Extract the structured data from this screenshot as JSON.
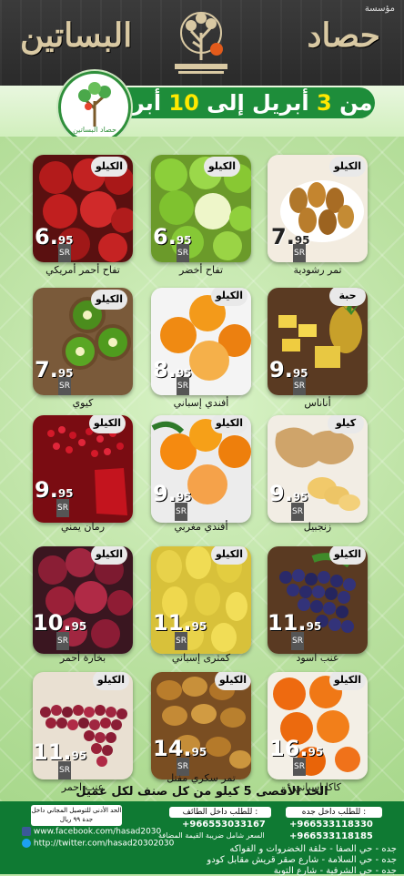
{
  "header": {
    "tag": "مؤسسة",
    "brand_right": "حصاد",
    "brand_left": "البساتين",
    "date_from": "من",
    "date_day1": "3",
    "date_mid": "أبريل إلى",
    "date_day2": "10",
    "date_end": "أبريل",
    "logo_text": "حصاد البساتين"
  },
  "products": [
    {
      "name": "تفاح أحمر أمريكي",
      "unit": "الكيلو",
      "price_int": "6.",
      "price_dec": "95",
      "currency": "SR"
    },
    {
      "name": "تفاح أخضر",
      "unit": "الكيلو",
      "price_int": "6.",
      "price_dec": "95",
      "currency": "SR"
    },
    {
      "name": "تمر رشودية",
      "unit": "الكيلو",
      "price_int": "7.",
      "price_dec": "95",
      "currency": "SR"
    },
    {
      "name": "كيوي",
      "unit": "الكيلو",
      "price_int": "7.",
      "price_dec": "95",
      "currency": "SR"
    },
    {
      "name": "أفندي إسباني",
      "unit": "الكيلو",
      "price_int": "8.",
      "price_dec": "95",
      "currency": "SR"
    },
    {
      "name": "أناناس",
      "unit": "حبة",
      "price_int": "9.",
      "price_dec": "95",
      "currency": "SR"
    },
    {
      "name": "رمان يمني",
      "unit": "الكيلو",
      "price_int": "9.",
      "price_dec": "95",
      "currency": "SR"
    },
    {
      "name": "أفندي مغربي",
      "unit": "الكيلو",
      "price_int": "9.",
      "price_dec": "95",
      "currency": "SR"
    },
    {
      "name": "زنجبيل",
      "unit": "كيلو",
      "price_int": "9.",
      "price_dec": "95",
      "currency": "SR"
    },
    {
      "name": "بخارة أحمر",
      "unit": "الكيلو",
      "price_int": "10.",
      "price_dec": "95",
      "currency": "SR"
    },
    {
      "name": "كمثرى إسباني",
      "unit": "الكيلو",
      "price_int": "11.",
      "price_dec": "95",
      "currency": "SR"
    },
    {
      "name": "عنب اسود",
      "unit": "الكيلو",
      "price_int": "11.",
      "price_dec": "95",
      "currency": "SR"
    },
    {
      "name": "عنب احمر",
      "unit": "الكيلو",
      "price_int": "11.",
      "price_dec": "95",
      "currency": "SR"
    },
    {
      "name": "تمر سكري مفتل",
      "unit": "الكيلو",
      "price_int": "14.",
      "price_dec": "95",
      "currency": "SR"
    },
    {
      "name": "كاكا إسباني",
      "unit": "الكيلو",
      "price_int": "16.",
      "price_dec": "95",
      "currency": "SR"
    }
  ],
  "limit": "الحد الأقصى 5 كيلو من كل صنف لكل عميل",
  "footer": {
    "min_order": "الحد الأدنى للتوصيل المجاني داخل جدة ٩٩ ريال",
    "facebook": "www.facebook.com/hasad2030",
    "twitter": "http://twitter.com/hasad20302030",
    "taif_title": "للطلب داخل الطائف :",
    "taif_phone": "+966553033167",
    "taif_loc": "السعر شامل ضريبة القيمة المضافة",
    "jeddah_title": "للطلب داخل جده :",
    "jeddah_phone1": "+966533118330",
    "jeddah_phone2": "+966533118185",
    "loc1": "جده - حي الصفا - حلقة الخضروات و الفواكه",
    "loc2": "جده - حي السلامة - شارع صقر قريش مقابل كودو",
    "loc3": "جده - حي الشرفية - شارع التوبة"
  }
}
